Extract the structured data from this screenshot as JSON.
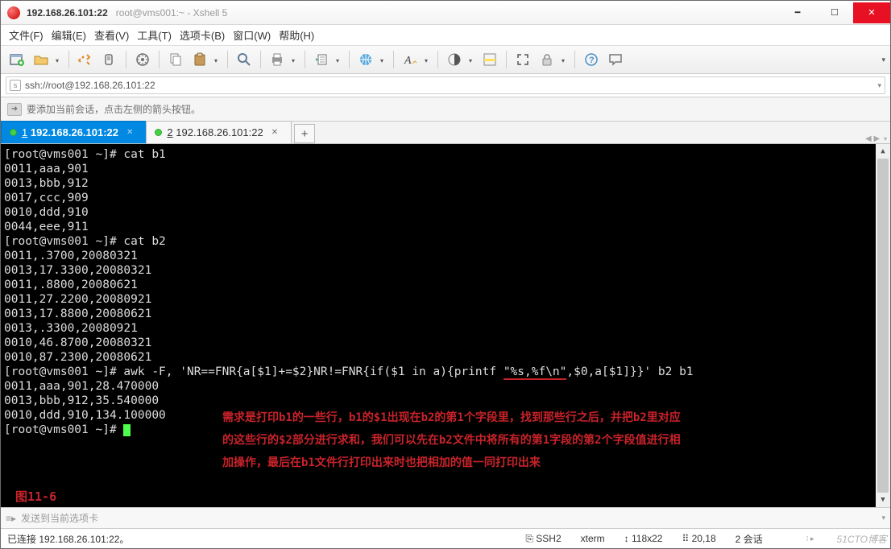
{
  "window": {
    "title_primary": "192.168.26.101:22",
    "title_secondary": "root@vms001:~ - Xshell 5"
  },
  "menu": [
    "文件(F)",
    "编辑(E)",
    "查看(V)",
    "工具(T)",
    "选项卡(B)",
    "窗口(W)",
    "帮助(H)"
  ],
  "url": "ssh://root@192.168.26.101:22",
  "tip": "要添加当前会话，点击左侧的箭头按钮。",
  "tabs": [
    {
      "num": "1",
      "label": "192.168.26.101:22",
      "active": true
    },
    {
      "num": "2",
      "label": "192.168.26.101:22",
      "active": false
    }
  ],
  "terminal": {
    "lines": [
      "[root@vms001 ~]# cat b1",
      "0011,aaa,901",
      "0013,bbb,912",
      "0017,ccc,909",
      "0010,ddd,910",
      "0044,eee,911",
      "[root@vms001 ~]# cat b2",
      "0011,.3700,20080321",
      "0013,17.3300,20080321",
      "0011,.8800,20080621",
      "0011,27.2200,20080921",
      "0013,17.8800,20080621",
      "0013,.3300,20080921",
      "0010,46.8700,20080321",
      "0010,87.2300,20080621"
    ],
    "awk_prefix": "[root@vms001 ~]# awk -F, 'NR==FNR{a[$1]+=$2}NR!=FNR{if($1 in a){printf ",
    "awk_under": "\"%s,%f\\n\"",
    "awk_suffix": ",$0,a[$1]}}' b2 b1",
    "after_lines": [
      "0011,aaa,901,28.470000",
      "0013,bbb,912,35.540000",
      "0010,ddd,910,134.100000"
    ],
    "prompt": "[root@vms001 ~]# ",
    "note_l1": "需求是打印b1的一些行，b1的$1出现在b2的第1个字段里，找到那些行之后，并把b2里对应",
    "note_l2": "的这些行的$2部分进行求和，我们可以先在b2文件中将所有的第1字段的第2个字段值进行相",
    "note_l3": "加操作，最后在b1文件行打印出来时也把相加的值一同打印出来",
    "fig": "图11-6"
  },
  "input_hint": "发送到当前选项卡",
  "status": {
    "conn": "已连接 192.168.26.101:22。",
    "ssh": "SSH2",
    "term": "xterm",
    "size": "118x22",
    "cursor": "20,18",
    "sess": "2 会话"
  },
  "watermark": "51CTO博客"
}
